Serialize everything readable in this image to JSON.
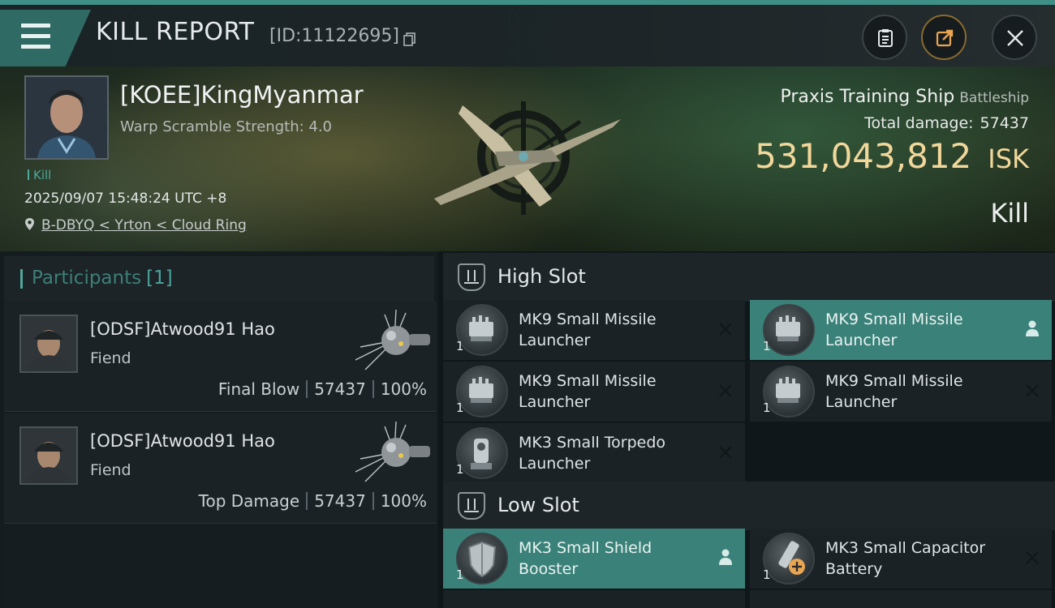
{
  "header": {
    "title": "KILL REPORT",
    "report_id": "[ID:11122695]"
  },
  "banner": {
    "pilot_name": "[KOEE]KingMyanmar",
    "warp_scramble": "Warp Scramble Strength: 4.0",
    "kill_tag": "Kill",
    "datetime": "2025/09/07 15:48:24 UTC +8",
    "location": "B-DBYQ < Yrton < Cloud Ring",
    "ship_name": "Praxis Training Ship",
    "ship_class": "Battleship",
    "total_damage_label": "Total damage:",
    "total_damage_value": "57437",
    "isk_value": "531,043,812",
    "isk_unit": "ISK",
    "result": "Kill"
  },
  "participants": {
    "label": "Participants",
    "count": "[1]",
    "rows": [
      {
        "name": "[ODSF]Atwood91 Hao",
        "ship": "Fiend",
        "role": "Final Blow",
        "damage": "57437",
        "percent": "100%"
      },
      {
        "name": "[ODSF]Atwood91 Hao",
        "ship": "Fiend",
        "role": "Top Damage",
        "damage": "57437",
        "percent": "100%"
      }
    ]
  },
  "fittings": {
    "high_slot": {
      "label": "High Slot",
      "modules": [
        {
          "name": "MK9 Small Missile Launcher",
          "qty": "1",
          "state": "destroyed"
        },
        {
          "name": "MK9 Small Missile Launcher",
          "qty": "1",
          "state": "dropped"
        },
        {
          "name": "MK9 Small Missile Launcher",
          "qty": "1",
          "state": "destroyed"
        },
        {
          "name": "MK9 Small Missile Launcher",
          "qty": "1",
          "state": "destroyed"
        },
        {
          "name": "MK3 Small Torpedo Launcher",
          "qty": "1",
          "state": "destroyed"
        }
      ]
    },
    "low_slot": {
      "label": "Low Slot",
      "modules": [
        {
          "name": "MK3 Small Shield Booster",
          "qty": "1",
          "state": "dropped"
        },
        {
          "name": "MK3 Small Capacitor Battery",
          "qty": "1",
          "state": "destroyed"
        }
      ]
    }
  },
  "colors": {
    "accent": "#3e8f85",
    "isk_gold": "#f2d79a",
    "dropped_highlight": "#3a8279"
  },
  "icons": [
    "menu-icon",
    "copy-icon",
    "clipboard-icon",
    "share-icon",
    "close-icon",
    "location-pin-icon",
    "slot-icon",
    "destroyed-x-icon",
    "person-icon"
  ]
}
